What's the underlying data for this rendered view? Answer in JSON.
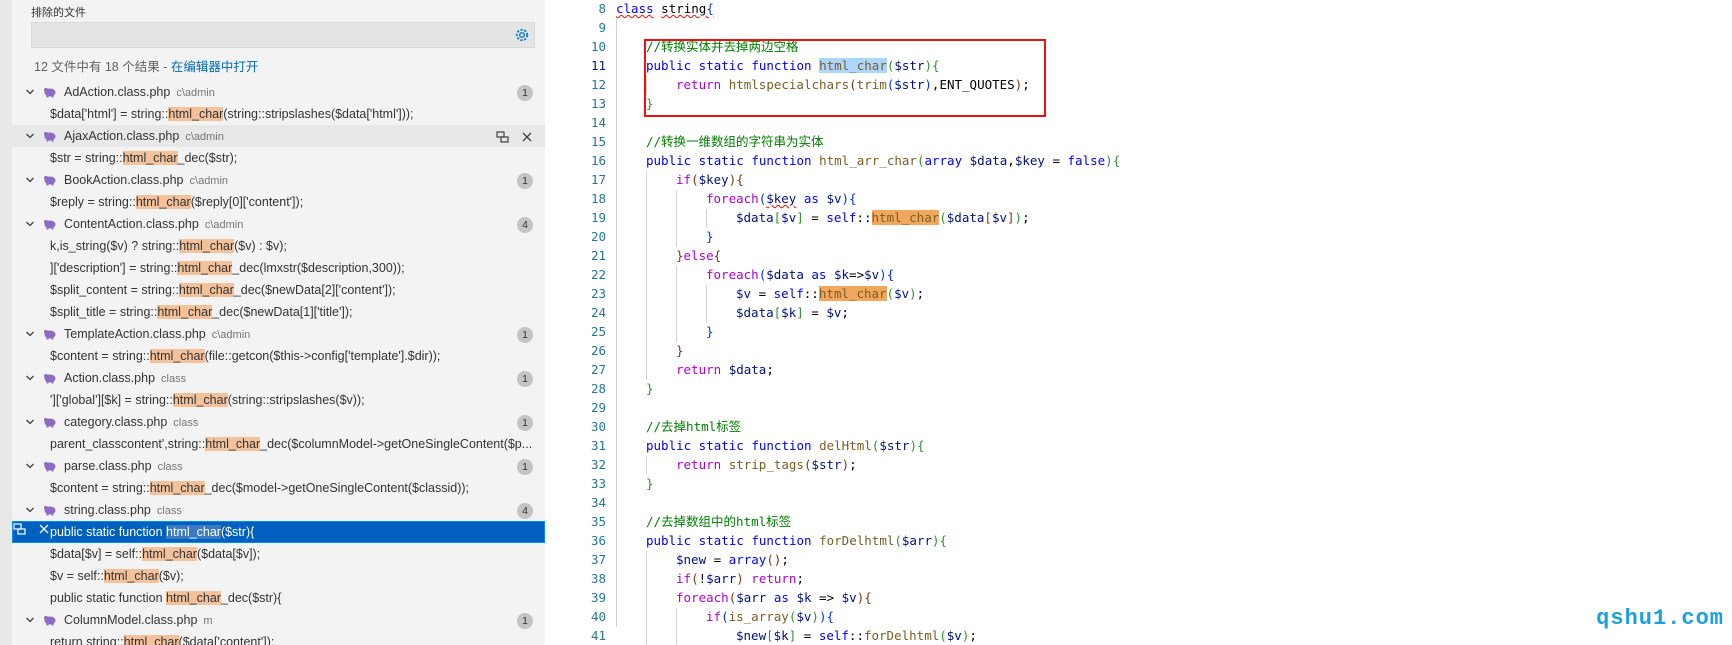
{
  "search": {
    "exclude_label": "排除的文件",
    "exclude_value": "",
    "summary_prefix": "12 文件中有 18 个结果 - ",
    "summary_link": "在编辑器中打开"
  },
  "results": [
    {
      "kind": "file",
      "name": "AdAction.class.php",
      "dir": "c\\admin",
      "count": "1"
    },
    {
      "kind": "match",
      "pre": "$data['html'] = string::",
      "hl": "html_char",
      "post": "(string::stripslashes($data['html']));"
    },
    {
      "kind": "file",
      "name": "AjaxAction.class.php",
      "dir": "c\\admin",
      "count": "",
      "hover": true
    },
    {
      "kind": "match",
      "pre": "$str = string::",
      "hl": "html_char",
      "post": "_dec($str);"
    },
    {
      "kind": "file",
      "name": "BookAction.class.php",
      "dir": "c\\admin",
      "count": "1"
    },
    {
      "kind": "match",
      "pre": "$reply = string::",
      "hl": "html_char",
      "post": "($reply[0]['content']);"
    },
    {
      "kind": "file",
      "name": "ContentAction.class.php",
      "dir": "c\\admin",
      "count": "4"
    },
    {
      "kind": "match",
      "pre": "k,is_string($v) ? string::",
      "hl": "html_char",
      "post": "($v) : $v);"
    },
    {
      "kind": "match",
      "pre": "]['description'] = string::",
      "hl": "html_char",
      "post": "_dec(lmxstr($description,300));"
    },
    {
      "kind": "match",
      "pre": "$split_content = string::",
      "hl": "html_char",
      "post": "_dec($newData[2]['content']);"
    },
    {
      "kind": "match",
      "pre": "$split_title = string::",
      "hl": "html_char",
      "post": "_dec($newData[1]['title']);"
    },
    {
      "kind": "file",
      "name": "TemplateAction.class.php",
      "dir": "c\\admin",
      "count": "1"
    },
    {
      "kind": "match",
      "pre": "$content = string::",
      "hl": "html_char",
      "post": "(file::getcon($this->config['template'].$dir));"
    },
    {
      "kind": "file",
      "name": "Action.class.php",
      "dir": "class",
      "count": "1"
    },
    {
      "kind": "match",
      "pre": "']['global'][$k] = string::",
      "hl": "html_char",
      "post": "(string::stripslashes($v));"
    },
    {
      "kind": "file",
      "name": "category.class.php",
      "dir": "class",
      "count": "1"
    },
    {
      "kind": "match",
      "pre": "parent_classcontent',string::",
      "hl": "html_char",
      "post": "_dec($columnModel->getOneSingleContent($p..."
    },
    {
      "kind": "file",
      "name": "parse.class.php",
      "dir": "class",
      "count": "1"
    },
    {
      "kind": "match",
      "pre": "$content = string::",
      "hl": "html_char",
      "post": "_dec($model->getOneSingleContent($classid));"
    },
    {
      "kind": "file",
      "name": "string.class.php",
      "dir": "class",
      "count": "4"
    },
    {
      "kind": "match",
      "pre": "public static function ",
      "hl": "html_char",
      "post": "($str){",
      "selected": true
    },
    {
      "kind": "match",
      "pre": "$data[$v] = self::",
      "hl": "html_char",
      "post": "($data[$v]);"
    },
    {
      "kind": "match",
      "pre": "$v = self::",
      "hl": "html_char",
      "post": "($v);"
    },
    {
      "kind": "match",
      "pre": "public static function ",
      "hl": "html_char",
      "post": "_dec($str){"
    },
    {
      "kind": "file",
      "name": "ColumnModel.class.php",
      "dir": "m",
      "count": "1"
    },
    {
      "kind": "match",
      "pre": "return string::",
      "hl": "html_char",
      "post": "($data['content']);"
    }
  ],
  "editor": {
    "line_numbers": [
      "8",
      "9",
      "10",
      "11",
      "12",
      "13",
      "14",
      "15",
      "16",
      "17",
      "18",
      "19",
      "20",
      "21",
      "22",
      "23",
      "24",
      "25",
      "26",
      "27",
      "28",
      "29",
      "30",
      "31",
      "32",
      "33",
      "34",
      "35",
      "36",
      "37",
      "38",
      "39",
      "40",
      "41"
    ],
    "active_line": "11"
  },
  "watermark": "qshu1.com",
  "colors": {
    "selection": "#0060c0",
    "find_highlight": "#f3c29b",
    "red_box": "#ee1111",
    "watermark": "#1a9fe0"
  }
}
